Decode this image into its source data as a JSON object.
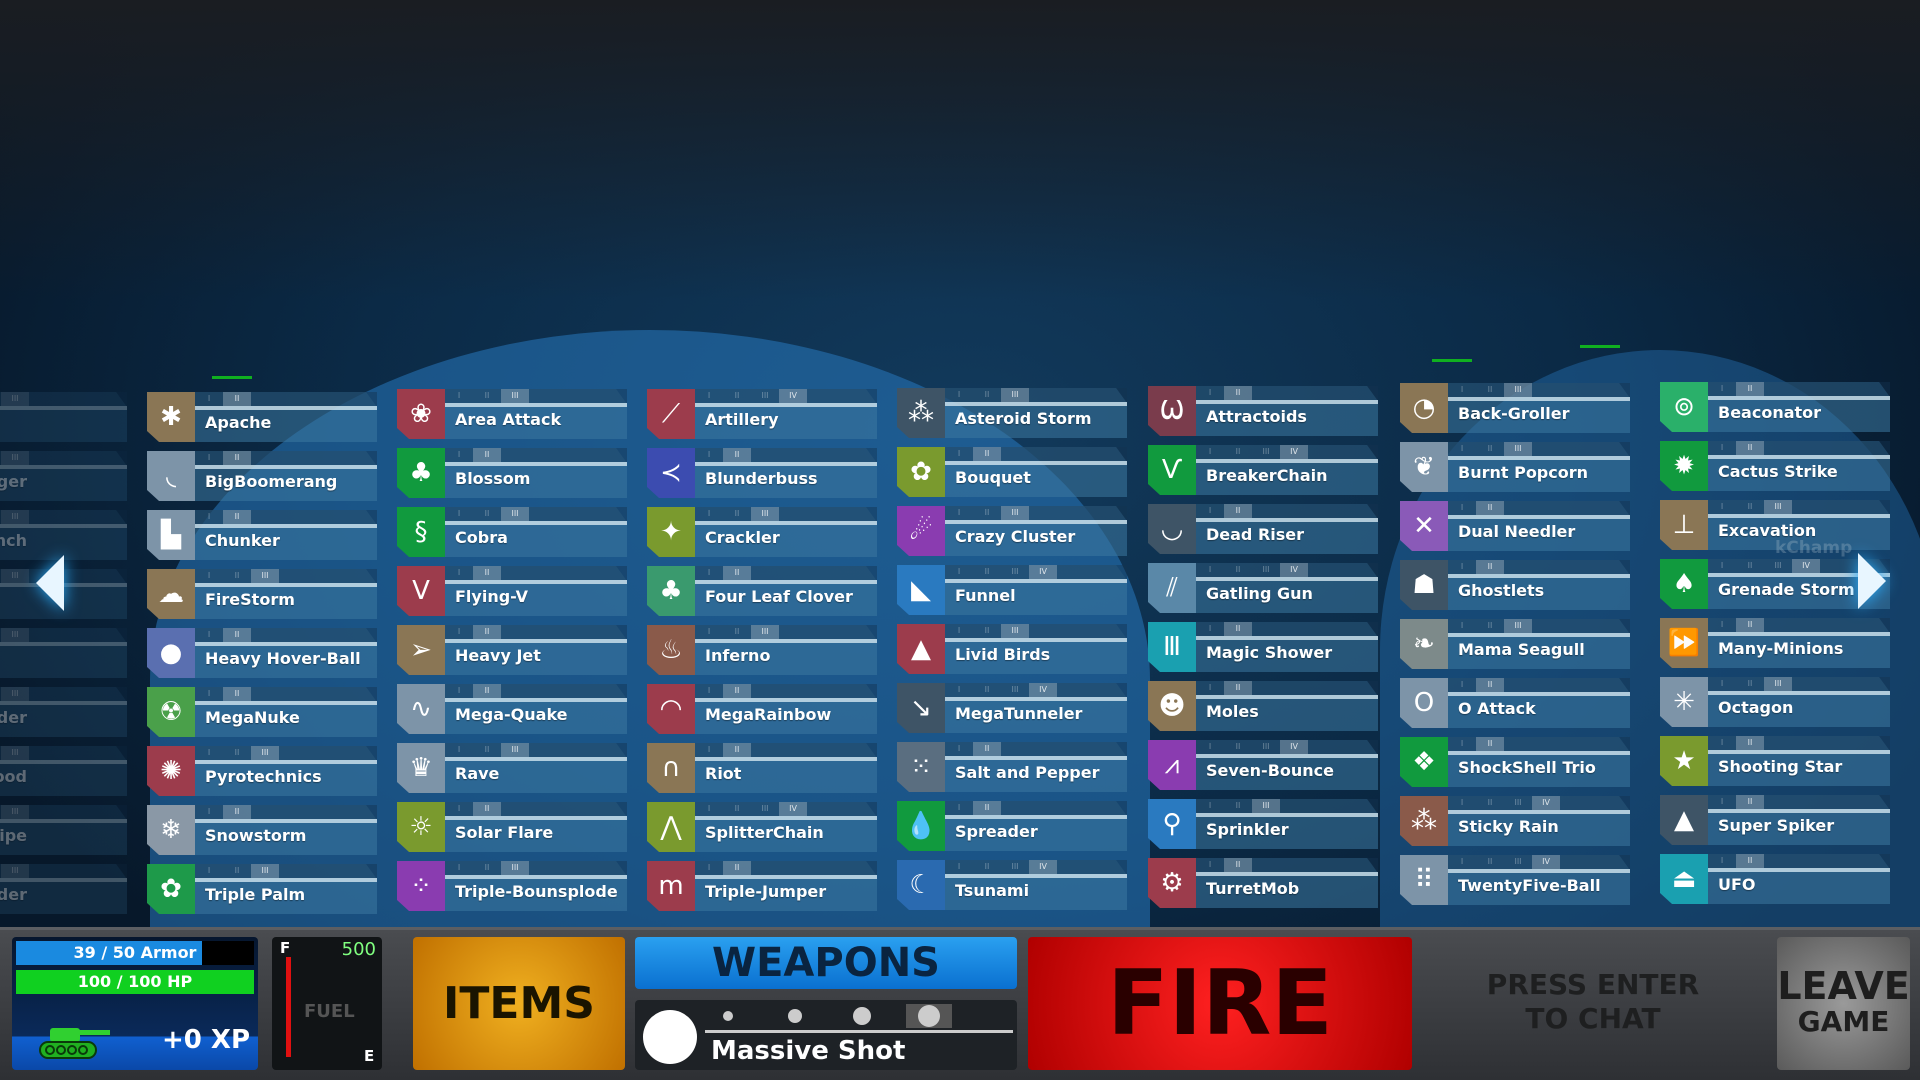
{
  "weapon_list": {
    "partial_column": [
      "",
      "ger",
      "n-Launch",
      "",
      "",
      "uilder",
      "ood",
      "nipe",
      "ounder"
    ],
    "columns": [
      [
        {
          "name": "Apache",
          "icon": "helicopter-icon",
          "glyph": "✱",
          "color": "#8a7655",
          "level": 2
        },
        {
          "name": "BigBoomerang",
          "icon": "boomerang-icon",
          "glyph": "◟",
          "color": "#7d94a8",
          "level": 2
        },
        {
          "name": "Chunker",
          "icon": "chunk-icon",
          "glyph": "▙",
          "color": "#7d94a8",
          "level": 2
        },
        {
          "name": "FireStorm",
          "icon": "storm-cloud-icon",
          "glyph": "☁",
          "color": "#8a7655",
          "level": 3
        },
        {
          "name": "Heavy Hover-Ball",
          "icon": "ball-icon",
          "glyph": "●",
          "color": "#5a6fb0",
          "level": 2
        },
        {
          "name": "MegaNuke",
          "icon": "radiation-icon",
          "glyph": "☢",
          "color": "#4aa04a",
          "level": 2
        },
        {
          "name": "Pyrotechnics",
          "icon": "firework-icon",
          "glyph": "✺",
          "color": "#9c3c4c",
          "level": 3
        },
        {
          "name": "Snowstorm",
          "icon": "snowballs-icon",
          "glyph": "❄",
          "color": "#8a98a6",
          "level": 2
        },
        {
          "name": "Triple Palm",
          "icon": "palm-icon",
          "glyph": "✿",
          "color": "#1e9a4a",
          "level": 3
        }
      ],
      [
        {
          "name": "Area Attack",
          "icon": "cluster-icon",
          "glyph": "❀",
          "color": "#9c3c4c",
          "level": 3
        },
        {
          "name": "Blossom",
          "icon": "flower-icon",
          "glyph": "♣",
          "color": "#119a3e",
          "level": 2
        },
        {
          "name": "Cobra",
          "icon": "snake-icon",
          "glyph": "§",
          "color": "#119a3e",
          "level": 3
        },
        {
          "name": "Flying-V",
          "icon": "v-icon",
          "glyph": "V",
          "color": "#9c3c4c",
          "level": 2
        },
        {
          "name": "Heavy Jet",
          "icon": "jet-icon",
          "glyph": "➢",
          "color": "#8a7655",
          "level": 2
        },
        {
          "name": "Mega-Quake",
          "icon": "seismograph-icon",
          "glyph": "∿",
          "color": "#7d94a8",
          "level": 2
        },
        {
          "name": "Rave",
          "icon": "crown-icon",
          "glyph": "♛",
          "color": "#7d94a8",
          "level": 3
        },
        {
          "name": "Solar Flare",
          "icon": "sun-icon",
          "glyph": "☼",
          "color": "#7a9a2e",
          "level": 2
        },
        {
          "name": "Triple-Bounsplode",
          "icon": "bubbles-icon",
          "glyph": "⁘",
          "color": "#8a3cb0",
          "level": 3
        }
      ],
      [
        {
          "name": "Artillery",
          "icon": "artillery-icon",
          "glyph": "⟋",
          "color": "#9c3c4c",
          "level": 4
        },
        {
          "name": "Blunderbuss",
          "icon": "spread-icon",
          "glyph": "≺",
          "color": "#3c4cb0",
          "level": 2
        },
        {
          "name": "Crackler",
          "icon": "sparkle-icon",
          "glyph": "✦",
          "color": "#7a9a2e",
          "level": 3
        },
        {
          "name": "Four Leaf Clover",
          "icon": "clover-icon",
          "glyph": "♣",
          "color": "#3a9a6e",
          "level": 2
        },
        {
          "name": "Inferno",
          "icon": "flame-icon",
          "glyph": "♨",
          "color": "#8a5a4a",
          "level": 3
        },
        {
          "name": "MegaRainbow",
          "icon": "rainbow-icon",
          "glyph": "◠",
          "color": "#9c3c4c",
          "level": 2
        },
        {
          "name": "Riot",
          "icon": "fountain-icon",
          "glyph": "∩",
          "color": "#8a7655",
          "level": 2
        },
        {
          "name": "SplitterChain",
          "icon": "split-icon",
          "glyph": "⋀",
          "color": "#7a9a2e",
          "level": 4
        },
        {
          "name": "Triple-Jumper",
          "icon": "jumps-icon",
          "glyph": "m",
          "color": "#9c3c4c",
          "level": 2
        }
      ],
      [
        {
          "name": "Asteroid Storm",
          "icon": "asteroids-icon",
          "glyph": "⁂",
          "color": "#3e5466",
          "level": 3
        },
        {
          "name": "Bouquet",
          "icon": "wreath-icon",
          "glyph": "✿",
          "color": "#7a9a2e",
          "level": 2
        },
        {
          "name": "Crazy Cluster",
          "icon": "comets-icon",
          "glyph": "☄",
          "color": "#8a3cb0",
          "level": 3
        },
        {
          "name": "Funnel",
          "icon": "funnel-icon",
          "glyph": "◣",
          "color": "#2a7ac0",
          "level": 4
        },
        {
          "name": "Livid Birds",
          "icon": "angry-bird-icon",
          "glyph": "▲",
          "color": "#9c3c4c",
          "level": 3
        },
        {
          "name": "MegaTunneler",
          "icon": "tunnel-icon",
          "glyph": "↘",
          "color": "#3e5466",
          "level": 4
        },
        {
          "name": "Salt and Pepper",
          "icon": "dots-icon",
          "glyph": "⁙",
          "color": "#5a6e80",
          "level": 2
        },
        {
          "name": "Spreader",
          "icon": "drops-icon",
          "glyph": "💧",
          "color": "#119a3e",
          "level": 2
        },
        {
          "name": "Tsunami",
          "icon": "wave-icon",
          "glyph": "☾",
          "color": "#2a6ab0",
          "level": 4
        }
      ],
      [
        {
          "name": "Attractoids",
          "icon": "claw-icon",
          "glyph": "Ѡ",
          "color": "#7a3c4c",
          "level": 2
        },
        {
          "name": "BreakerChain",
          "icon": "chain-split-icon",
          "glyph": "Ѵ",
          "color": "#119a3e",
          "level": 4
        },
        {
          "name": "Dead Riser",
          "icon": "grave-icon",
          "glyph": "◡",
          "color": "#3e5466",
          "level": 2
        },
        {
          "name": "Gatling Gun",
          "icon": "gatling-icon",
          "glyph": "⫽",
          "color": "#5a88a8",
          "level": 4
        },
        {
          "name": "Magic Shower",
          "icon": "bars-icon",
          "glyph": "Ⅲ",
          "color": "#1aa0b0",
          "level": 2
        },
        {
          "name": "Moles",
          "icon": "mole-icon",
          "glyph": "☻",
          "color": "#8a7655",
          "level": 2
        },
        {
          "name": "Seven-Bounce",
          "icon": "bounce-icon",
          "glyph": "⩘",
          "color": "#8a3cb0",
          "level": 4
        },
        {
          "name": "Sprinkler",
          "icon": "faucet-icon",
          "glyph": "⚲",
          "color": "#2a7ac0",
          "level": 3
        },
        {
          "name": "TurretMob",
          "icon": "turret-icon",
          "glyph": "⚙",
          "color": "#9c3c4c",
          "level": 2
        }
      ],
      [
        {
          "name": "Back-Groller",
          "icon": "roller-icon",
          "glyph": "◔",
          "color": "#8a7655",
          "level": 3
        },
        {
          "name": "Burnt Popcorn",
          "icon": "popcorn-icon",
          "glyph": "❦",
          "color": "#7d94a8",
          "level": 3
        },
        {
          "name": "Dual Needler",
          "icon": "needles-icon",
          "glyph": "✕",
          "color": "#8a5ab8",
          "level": 2
        },
        {
          "name": "Ghostlets",
          "icon": "ghost-icon",
          "glyph": "☗",
          "color": "#3e5466",
          "level": 2
        },
        {
          "name": "Mama Seagull",
          "icon": "seagull-icon",
          "glyph": "❧",
          "color": "#7d8a8a",
          "level": 3
        },
        {
          "name": "O Attack",
          "icon": "ring-icon",
          "glyph": "O",
          "color": "#7d94a8",
          "level": 2
        },
        {
          "name": "ShockShell Trio",
          "icon": "shells-icon",
          "glyph": "❖",
          "color": "#119a3e",
          "level": 2
        },
        {
          "name": "Sticky Rain",
          "icon": "sticky-drops-icon",
          "glyph": "⁂",
          "color": "#8a5a4a",
          "level": 4
        },
        {
          "name": "TwentyFive-Ball",
          "icon": "grid-dots-icon",
          "glyph": "⠿",
          "color": "#7d94a8",
          "level": 4
        }
      ],
      [
        {
          "name": "Beaconator",
          "icon": "beacon-icon",
          "glyph": "⊚",
          "color": "#2ab06a",
          "level": 2
        },
        {
          "name": "Cactus Strike",
          "icon": "cactus-icon",
          "glyph": "✹",
          "color": "#119a3e",
          "level": 2
        },
        {
          "name": "Excavation",
          "icon": "excavator-icon",
          "glyph": "⊥",
          "color": "#8a7655",
          "level": 3
        },
        {
          "name": "Grenade Storm",
          "icon": "grenades-icon",
          "glyph": "♠",
          "color": "#119a3e",
          "level": 4
        },
        {
          "name": "Many-Minions",
          "icon": "minions-icon",
          "glyph": "⏩",
          "color": "#8a7655",
          "level": 2
        },
        {
          "name": "Octagon",
          "icon": "octagon-icon",
          "glyph": "✳",
          "color": "#7d94a8",
          "level": 3
        },
        {
          "name": "Shooting Star",
          "icon": "star-icon",
          "glyph": "★",
          "color": "#7a9a2e",
          "level": 2
        },
        {
          "name": "Super Spiker",
          "icon": "spike-icon",
          "glyph": "▲",
          "color": "#3e5466",
          "level": 2
        },
        {
          "name": "UFO",
          "icon": "ufo-icon",
          "glyph": "⏏",
          "color": "#1aa0b0",
          "level": 2
        }
      ]
    ],
    "tier_labels": [
      "I",
      "II",
      "III",
      "IV"
    ],
    "player_tag": "kChamp"
  },
  "status": {
    "armor": 39,
    "armor_max": 50,
    "armor_text": "39 / 50 Armor",
    "hp_text": "100 / 100 HP",
    "hp_fraction": 1.0,
    "xp_text": "+0 XP"
  },
  "fuel": {
    "full_label": "F",
    "empty_label": "E",
    "label": "FUEL",
    "amount": "500"
  },
  "buttons": {
    "items": "ITEMS",
    "weapons": "WEAPONS",
    "fire": "FIRE",
    "leave_1": "LEAVE",
    "leave_2": "GAME"
  },
  "selected_weapon": {
    "name": "Massive Shot",
    "power_levels": 4,
    "selected_power": 4
  },
  "chat": {
    "line1": "PRESS ENTER",
    "line2": "TO CHAT"
  },
  "colors": {
    "armor": "#1a8ae0",
    "hp": "#10d020",
    "fire": "#e01010",
    "items": "#e0a020",
    "weapons": "#1a88e0"
  }
}
